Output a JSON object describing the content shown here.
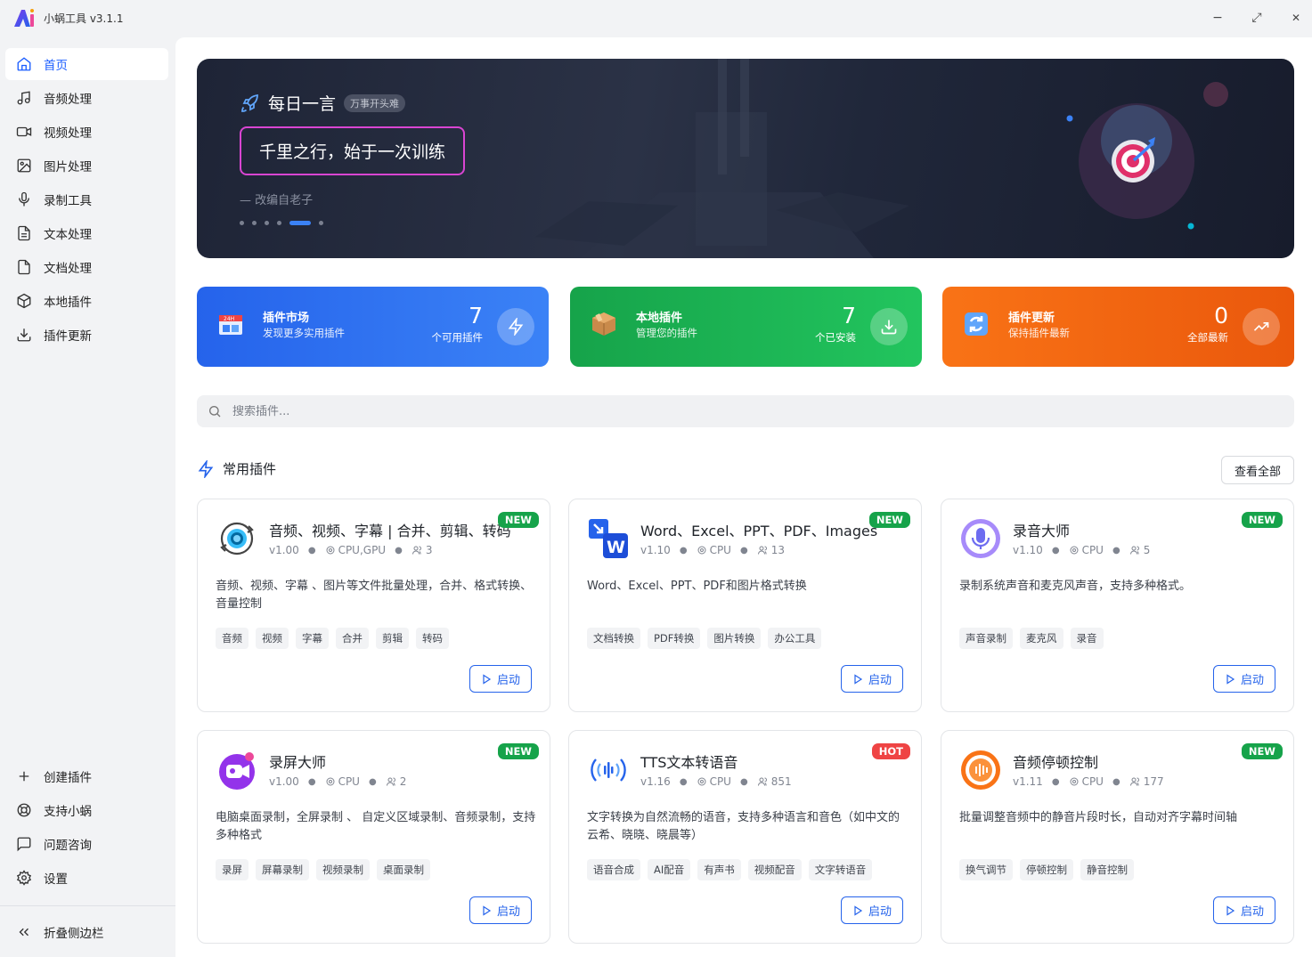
{
  "app": {
    "title": "小蜗工具 v3.1.1"
  },
  "window_controls": {
    "minimize": "−",
    "maximize": "⤢",
    "close": "✕"
  },
  "sidebar": {
    "items": [
      {
        "label": "首页",
        "icon": "home-icon",
        "active": true
      },
      {
        "label": "音频处理",
        "icon": "music-note-icon"
      },
      {
        "label": "视频处理",
        "icon": "video-camera-icon"
      },
      {
        "label": "图片处理",
        "icon": "image-icon"
      },
      {
        "label": "录制工具",
        "icon": "microphone-icon"
      },
      {
        "label": "文本处理",
        "icon": "text-document-icon"
      },
      {
        "label": "文档处理",
        "icon": "file-icon"
      },
      {
        "label": "本地插件",
        "icon": "package-icon"
      },
      {
        "label": "插件更新",
        "icon": "download-icon"
      }
    ],
    "bottom_items": [
      {
        "label": "创建插件",
        "icon": "plus-icon"
      },
      {
        "label": "支持小蜗",
        "icon": "lifebuoy-icon"
      },
      {
        "label": "问题咨询",
        "icon": "chat-icon"
      },
      {
        "label": "设置",
        "icon": "gear-icon"
      }
    ],
    "collapse_label": "折叠侧边栏"
  },
  "banner": {
    "title": "每日一言",
    "badge": "万事开头难",
    "quote": "千里之行，始于一次训练",
    "source": "— 改编自老子",
    "slide_count": 6,
    "active_slide": 5
  },
  "stats": [
    {
      "title": "插件市场",
      "subtitle": "发现更多实用插件",
      "value": "7",
      "value_label": "个可用插件",
      "color": "#2563eb",
      "icon": "calendar-24h-icon",
      "action_icon": "lightning-icon"
    },
    {
      "title": "本地插件",
      "subtitle": "管理您的插件",
      "value": "7",
      "value_label": "个已安装",
      "color": "#16a34a",
      "icon": "box-icon",
      "action_icon": "download-icon"
    },
    {
      "title": "插件更新",
      "subtitle": "保持插件最新",
      "value": "0",
      "value_label": "全部最新",
      "color": "#f97316",
      "icon": "refresh-icon",
      "action_icon": "trending-up-icon"
    }
  ],
  "search": {
    "placeholder": "搜索插件..."
  },
  "section": {
    "title": "常用插件",
    "view_all": "查看全部"
  },
  "launch_label": "启动",
  "plugins": [
    {
      "name": "音频、视频、字幕 | 合并、剪辑、转码",
      "version": "v1.00",
      "hardware": "CPU,GPU",
      "users": "3",
      "badge": "NEW",
      "desc": "音频、视频、字幕 、图片等文件批量处理，合并、格式转换、音量控制",
      "tags": [
        "音频",
        "视频",
        "字幕",
        "合并",
        "剪辑",
        "转码"
      ],
      "icon": "media-convert-icon"
    },
    {
      "name": "Word、Excel、PPT、PDF、Images",
      "version": "v1.10",
      "hardware": "CPU",
      "users": "13",
      "badge": "NEW",
      "desc": "Word、Excel、PPT、PDF和图片格式转换",
      "tags": [
        "文档转换",
        "PDF转换",
        "图片转换",
        "办公工具"
      ],
      "icon": "word-convert-icon"
    },
    {
      "name": "录音大师",
      "version": "v1.10",
      "hardware": "CPU",
      "users": "5",
      "badge": "NEW",
      "desc": "录制系统声音和麦克风声音，支持多种格式。",
      "tags": [
        "声音录制",
        "麦克风",
        "录音"
      ],
      "icon": "recorder-mic-icon"
    },
    {
      "name": "录屏大师",
      "version": "v1.00",
      "hardware": "CPU",
      "users": "2",
      "badge": "NEW",
      "desc": "电脑桌面录制，全屏录制 、 自定义区域录制、音频录制，支持多种格式",
      "tags": [
        "录屏",
        "屏幕录制",
        "视频录制",
        "桌面录制"
      ],
      "icon": "screen-record-icon"
    },
    {
      "name": "TTS文本转语音",
      "version": "v1.16",
      "hardware": "CPU",
      "users": "851",
      "badge": "HOT",
      "desc": "文字转换为自然流畅的语音，支持多种语言和音色（如中文的云希、晓晓、晓晨等）",
      "tags": [
        "语音合成",
        "AI配音",
        "有声书",
        "视频配音",
        "文字转语音"
      ],
      "icon": "tts-wave-icon"
    },
    {
      "name": "音频停顿控制",
      "version": "v1.11",
      "hardware": "CPU",
      "users": "177",
      "badge": "NEW",
      "desc": "批量调整音频中的静音片段时长，自动对齐字幕时间轴",
      "tags": [
        "换气调节",
        "停顿控制",
        "静音控制"
      ],
      "icon": "audio-pause-icon"
    }
  ],
  "colors": {
    "accent": "#2563eb",
    "new_badge": "#16a34a",
    "hot_badge": "#ef4444"
  }
}
